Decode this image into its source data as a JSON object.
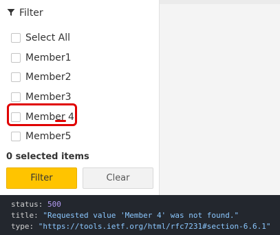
{
  "filter": {
    "title": "Filter",
    "items": [
      {
        "label": "Select All",
        "checked": false
      },
      {
        "label": "Member1",
        "checked": false
      },
      {
        "label": "Member2",
        "checked": false
      },
      {
        "label": "Member3",
        "checked": false
      },
      {
        "label": "Member 4",
        "checked": false
      },
      {
        "label": "Member5",
        "checked": false
      }
    ],
    "summary": "0 selected items",
    "filter_button": "Filter",
    "clear_button": "Clear"
  },
  "response": {
    "status_key": "status",
    "status_value": "500",
    "title_key": "title",
    "title_value": "\"Requested value 'Member 4' was not found.\"",
    "type_key": "type",
    "type_value": "\"https://tools.ietf.org/html/rfc7231#section-6.6.1\""
  },
  "colors": {
    "accent": "#ffc400",
    "highlight": "#e00000",
    "code_bg": "#23272e"
  }
}
